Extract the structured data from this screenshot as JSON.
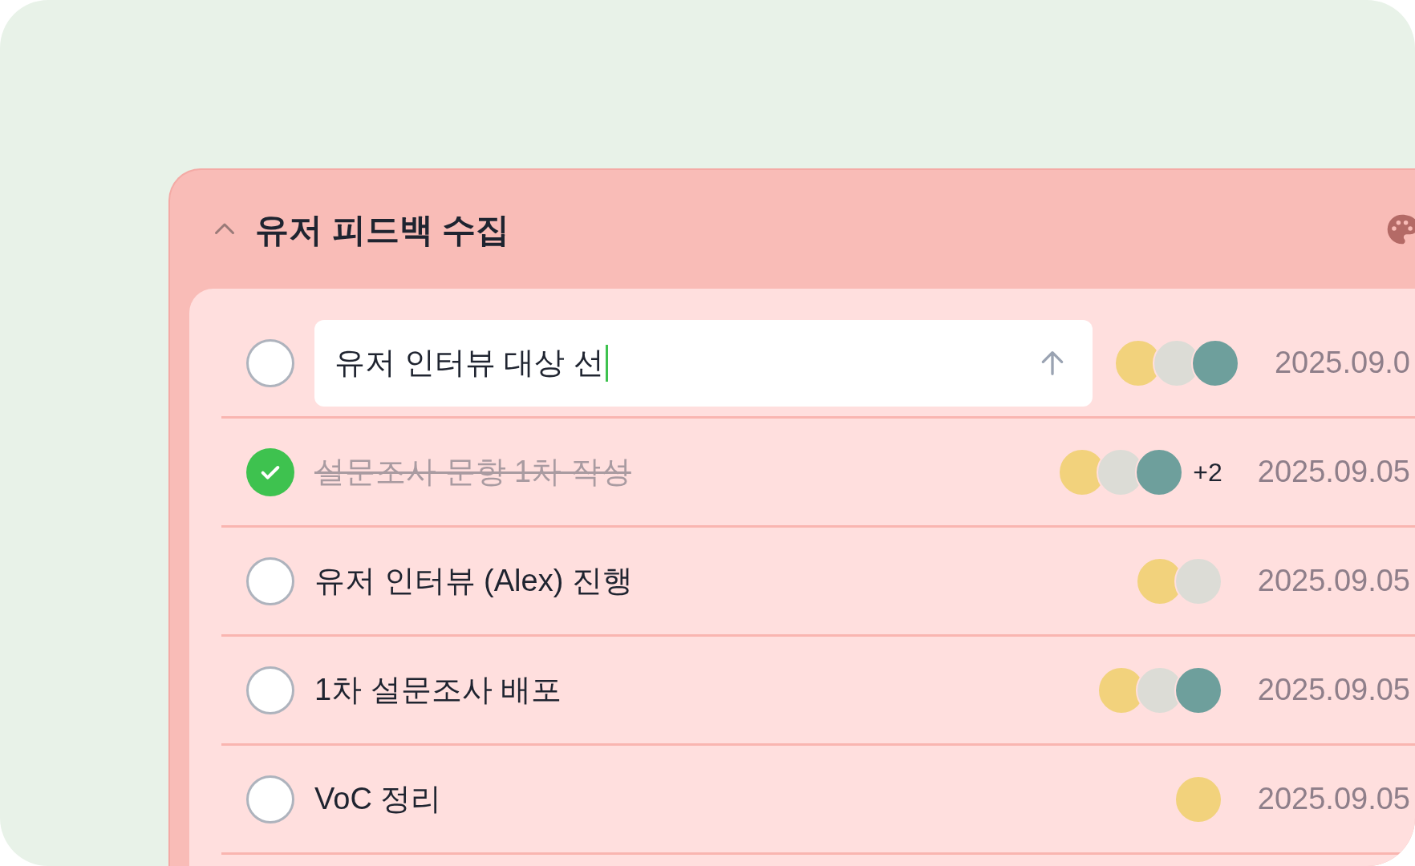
{
  "group": {
    "title": "유저 피드백 수집",
    "expanded": true
  },
  "tasks": [
    {
      "kind": "input",
      "checked": false,
      "value": "유저 인터뷰 대상 선",
      "avatars": [
        {
          "color": "#f2d27c"
        },
        {
          "color": "#dcdcd6"
        },
        {
          "color": "#6e9f9c"
        }
      ],
      "date": "2025.09.0"
    },
    {
      "kind": "text",
      "checked": true,
      "label": "설문조사 문항 1차 작성",
      "avatars": [
        {
          "color": "#f2d27c"
        },
        {
          "color": "#dcdcd6"
        },
        {
          "color": "#6e9f9c"
        }
      ],
      "more": "+2",
      "date": "2025.09.05"
    },
    {
      "kind": "text",
      "checked": false,
      "label": "유저 인터뷰 (Alex) 진행",
      "avatars": [
        {
          "color": "#f2d27c"
        },
        {
          "color": "#dcdcd6"
        }
      ],
      "date": "2025.09.05"
    },
    {
      "kind": "text",
      "checked": false,
      "label": "1차 설문조사 배포",
      "avatars": [
        {
          "color": "#f2d27c"
        },
        {
          "color": "#dcdcd6"
        },
        {
          "color": "#6e9f9c"
        }
      ],
      "date": "2025.09.05"
    },
    {
      "kind": "text",
      "checked": false,
      "label": "VoC 정리",
      "avatars": [
        {
          "color": "#f2d27c"
        }
      ],
      "date": "2025.09.05"
    }
  ]
}
